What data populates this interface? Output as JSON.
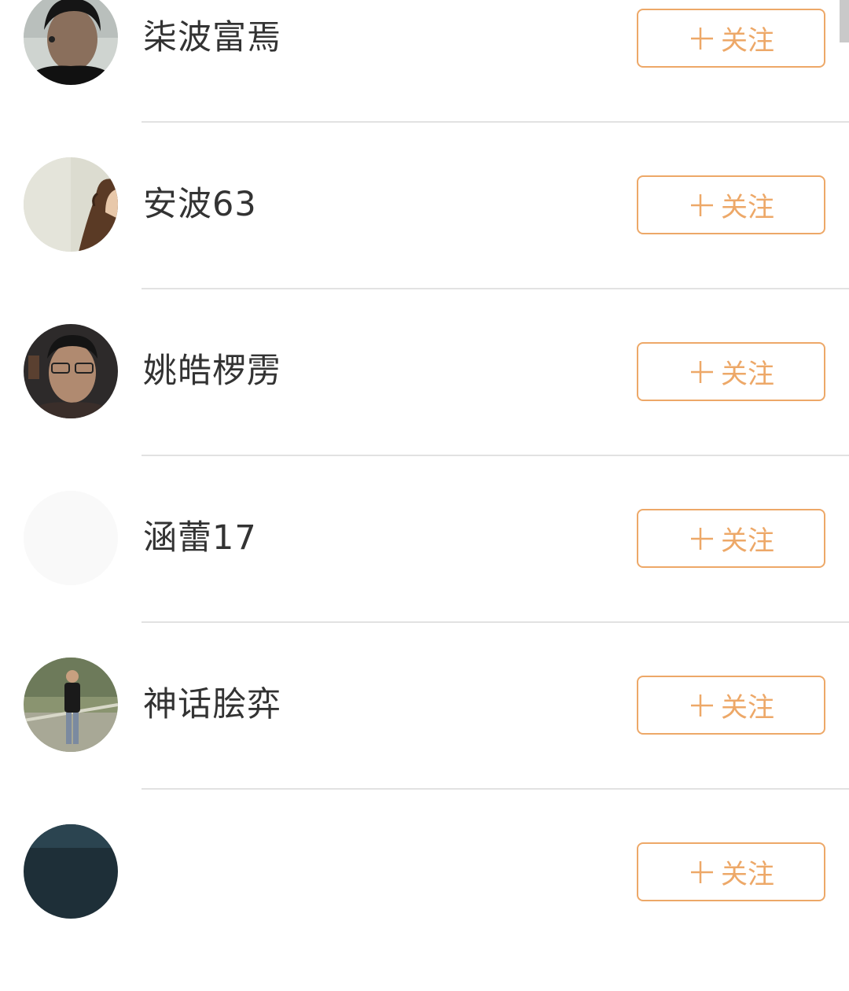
{
  "follow_list": {
    "accent_color": "#EDA868",
    "follow_label": "关注",
    "users": [
      {
        "name": "柒波富焉",
        "avatar": "young-man-dark-hair-photo"
      },
      {
        "name": "安波63",
        "avatar": "ponytail-profile-photo"
      },
      {
        "name": "姚皓椤雳",
        "avatar": "man-with-glasses-photo"
      },
      {
        "name": "涵蕾17",
        "avatar": "blank-avatar"
      },
      {
        "name": "神话脍弈",
        "avatar": "person-standing-outdoors-photo"
      },
      {
        "name": "",
        "avatar": "dark-photo-partial"
      }
    ]
  }
}
